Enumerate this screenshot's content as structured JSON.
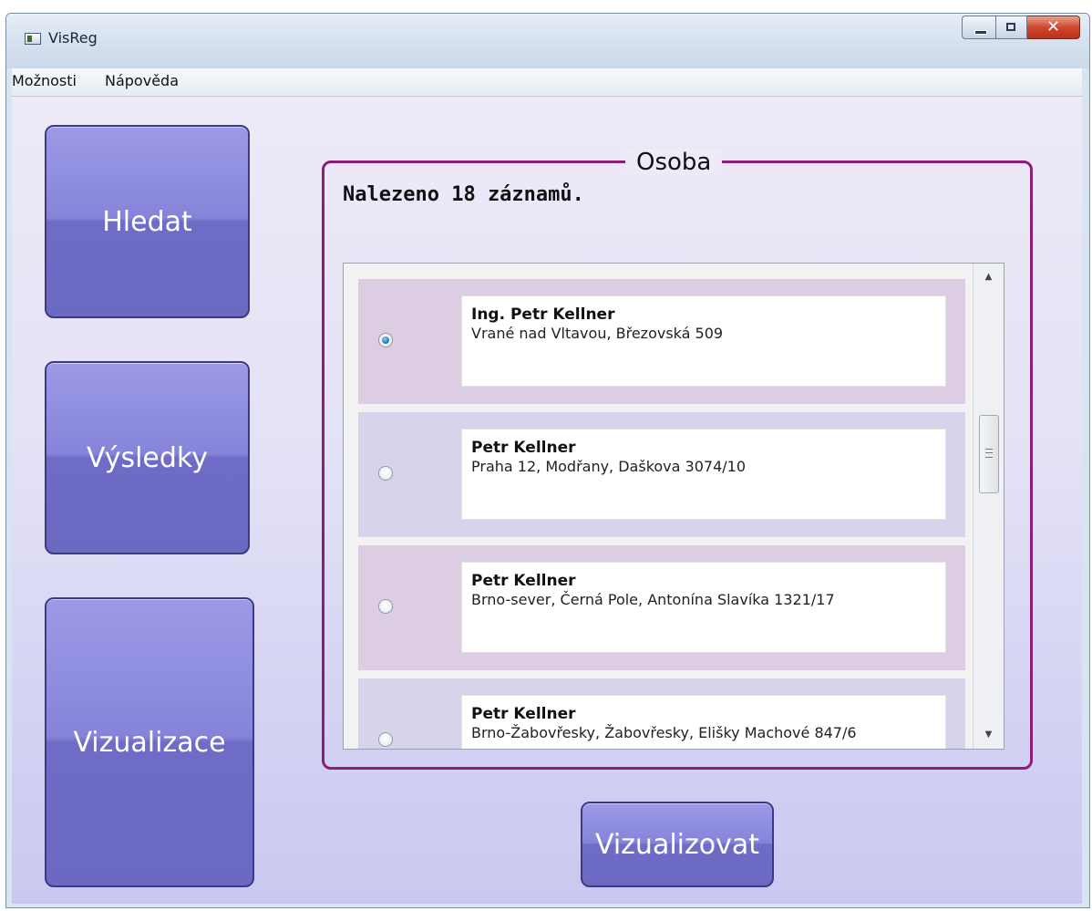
{
  "window": {
    "title": "VisReg",
    "controls": {
      "minimize": "minimize-icon",
      "maximize": "maximize-icon",
      "close": "close-icon"
    }
  },
  "menu": {
    "items": [
      {
        "label": "Možnosti"
      },
      {
        "label": "Nápověda"
      }
    ]
  },
  "sidebar": {
    "buttons": [
      {
        "label": "Hledat"
      },
      {
        "label": "Výsledky"
      },
      {
        "label": "Vizualizace"
      }
    ]
  },
  "group": {
    "legend": "Osoba",
    "count_label": "Nalezeno 18 záznamů."
  },
  "results": [
    {
      "name": "Ing. Petr Kellner",
      "address": "Vrané nad Vltavou, Březovská 509",
      "selected": true
    },
    {
      "name": "Petr Kellner",
      "address": "Praha 12, Modřany, Daškova 3074/10",
      "selected": false
    },
    {
      "name": "Petr Kellner",
      "address": "Brno-sever, Černá Pole, Antonína Slavíka 1321/17",
      "selected": false
    },
    {
      "name": "Petr Kellner",
      "address": "Brno-Žabovřesky, Žabovřesky, Elišky Machové 847/6",
      "selected": false
    }
  ],
  "actions": {
    "visualize_label": "Vizualizovat"
  },
  "colors": {
    "button_fill": "#7b79d3",
    "button_border": "#3d3a85",
    "group_border": "#8a1e78",
    "row_odd": "#dccde3",
    "row_even": "#d6d4ea"
  }
}
